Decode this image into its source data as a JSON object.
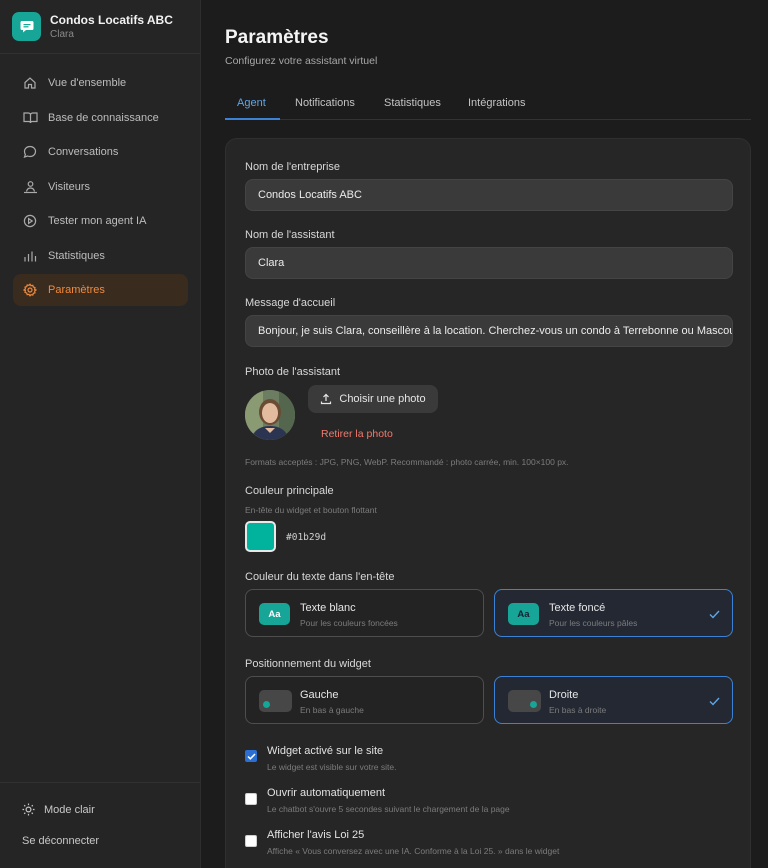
{
  "brand": {
    "name": "Condos Locatifs ABC",
    "subtitle": "Clara"
  },
  "sidebar": {
    "items": [
      {
        "label": "Vue d'ensemble",
        "icon": "home-icon"
      },
      {
        "label": "Base de connaissance",
        "icon": "book-icon"
      },
      {
        "label": "Conversations",
        "icon": "chat-icon"
      },
      {
        "label": "Visiteurs",
        "icon": "visitors-icon"
      },
      {
        "label": "Tester mon agent IA",
        "icon": "play-icon"
      },
      {
        "label": "Statistiques",
        "icon": "bar-chart-icon"
      },
      {
        "label": "Paramètres",
        "icon": "gear-icon",
        "active": true
      }
    ],
    "mode_label": "Mode clair",
    "logout_label": "Se déconnecter"
  },
  "header": {
    "title": "Paramètres",
    "subtitle": "Configurez votre assistant virtuel"
  },
  "tabs": [
    {
      "label": "Agent",
      "active": true
    },
    {
      "label": "Notifications"
    },
    {
      "label": "Statistiques"
    },
    {
      "label": "Intégrations"
    }
  ],
  "form": {
    "company": {
      "label": "Nom de l'entreprise",
      "value": "Condos Locatifs ABC"
    },
    "assistant": {
      "label": "Nom de l'assistant",
      "value": "Clara"
    },
    "welcome": {
      "label": "Message d'accueil",
      "value": "Bonjour, je suis Clara, conseillère à la location. Cherchez-vous un condo à Terrebonne ou Mascouche ?"
    },
    "photo": {
      "label": "Photo de l'assistant",
      "choose_label": "Choisir une photo",
      "remove_label": "Retirer la photo",
      "formats_hint": "Formats acceptés : JPG, PNG, WebP. Recommandé : photo carrée, min. 100×100 px."
    },
    "color": {
      "label": "Couleur principale",
      "hint": "En-tête du widget et bouton flottant",
      "value": "#01b29d"
    },
    "header_text_color": {
      "label": "Couleur du texte dans l'en-tête",
      "options": [
        {
          "chip": "Aa",
          "title": "Texte blanc",
          "subtitle": "Pour les couleurs foncées",
          "selected": false
        },
        {
          "chip": "Aa",
          "title": "Texte foncé",
          "subtitle": "Pour les couleurs pâles",
          "selected": true
        }
      ]
    },
    "position": {
      "label": "Positionnement du widget",
      "options": [
        {
          "title": "Gauche",
          "subtitle": "En bas à gauche",
          "selected": false
        },
        {
          "title": "Droite",
          "subtitle": "En bas à droite",
          "selected": true
        }
      ]
    },
    "checkboxes": [
      {
        "title": "Widget activé sur le site",
        "subtitle": "Le widget est visible sur votre site.",
        "checked": true
      },
      {
        "title": "Ouvrir automatiquement",
        "subtitle": "Le chatbot s'ouvre 5 secondes suivant le chargement de la page",
        "checked": false
      },
      {
        "title": "Afficher l'avis Loi 25",
        "subtitle": "Affiche « Vous conversez avec une IA. Conforme à la Loi 25. » dans le widget",
        "checked": false
      }
    ]
  },
  "colors": {
    "accent": "#f08a3c",
    "brand": "#16a596",
    "primary_blue": "#3b82d6"
  }
}
